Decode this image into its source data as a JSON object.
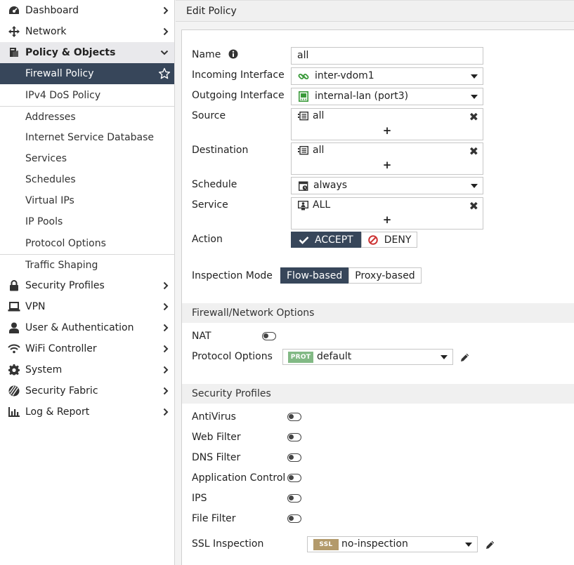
{
  "sidebar": {
    "top_items": [
      {
        "label": "Dashboard",
        "icon": "dashboard-icon"
      },
      {
        "label": "Network",
        "icon": "network-icon"
      },
      {
        "label": "Policy & Objects",
        "icon": "policy-icon"
      }
    ],
    "sub_items": [
      "Firewall Policy",
      "IPv4 DoS Policy",
      "Addresses",
      "Internet Service Database",
      "Services",
      "Schedules",
      "Virtual IPs",
      "IP Pools",
      "Protocol Options",
      "Traffic Shaping"
    ],
    "bottom_items": [
      "Security Profiles",
      "VPN",
      "User & Authentication",
      "WiFi Controller",
      "System",
      "Security Fabric",
      "Log & Report"
    ]
  },
  "page": {
    "title": "Edit Policy"
  },
  "form": {
    "name": {
      "label": "Name",
      "value": "all"
    },
    "incoming": {
      "label": "Incoming Interface",
      "value": "inter-vdom1"
    },
    "outgoing": {
      "label": "Outgoing Interface",
      "value": "internal-lan (port3)"
    },
    "source": {
      "label": "Source",
      "value": "all"
    },
    "destination": {
      "label": "Destination",
      "value": "all"
    },
    "schedule": {
      "label": "Schedule",
      "value": "always"
    },
    "service": {
      "label": "Service",
      "value": "ALL"
    },
    "action": {
      "label": "Action",
      "accept": "ACCEPT",
      "deny": "DENY",
      "selected": "ACCEPT"
    },
    "inspection": {
      "label": "Inspection Mode",
      "flow": "Flow-based",
      "proxy": "Proxy-based",
      "selected": "Flow-based"
    },
    "plus": "+"
  },
  "firewall_options": {
    "title": "Firewall/Network Options",
    "nat": {
      "label": "NAT",
      "enabled": false
    },
    "protocol_options": {
      "label": "Protocol Options",
      "tag": "PROT",
      "value": "default"
    }
  },
  "security_profiles": {
    "title": "Security Profiles",
    "items": [
      {
        "label": "AntiVirus",
        "enabled": false
      },
      {
        "label": "Web Filter",
        "enabled": false
      },
      {
        "label": "DNS Filter",
        "enabled": false
      },
      {
        "label": "Application Control",
        "enabled": false
      },
      {
        "label": "IPS",
        "enabled": false
      },
      {
        "label": "File Filter",
        "enabled": false
      }
    ],
    "ssl": {
      "label": "SSL Inspection",
      "tag": "SSL",
      "value": "no-inspection"
    }
  },
  "colors": {
    "active_nav": "#37465a",
    "prot_tag": "#82b985",
    "ssl_tag": "#b39a6b",
    "interface_icon": "#3a9a3a",
    "deny_icon": "#cc3333"
  }
}
